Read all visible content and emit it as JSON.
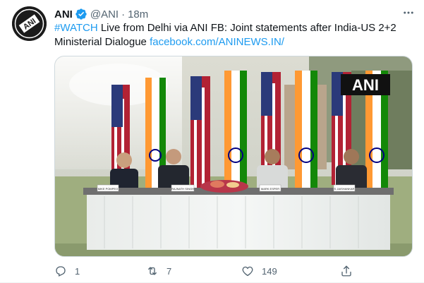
{
  "author": {
    "name": "ANI",
    "handle": "@ANI",
    "separator": "·",
    "time": "18m",
    "avatar_text": "ANI",
    "verified_icon": "verified-badge-icon",
    "verified_color": "#1d9bf0"
  },
  "tweet": {
    "hashtag": "#WATCH",
    "text_line1_rest": " Live from Delhi via ANI FB: Joint statements after India-US 2+2",
    "text_line2": "Ministerial Dialogue ",
    "link": "facebook.com/ANINEWS.IN/"
  },
  "media": {
    "watermark": "ANI",
    "nameplates": [
      "MIKE POMPEO",
      "RAJNATH SINGH",
      "MARK ESPER",
      "S JAISHANKAR"
    ]
  },
  "actions": {
    "reply_count": "1",
    "retweet_count": "7",
    "like_count": "149",
    "reply_icon": "reply-icon",
    "retweet_icon": "retweet-icon",
    "like_icon": "heart-icon",
    "share_icon": "share-icon"
  },
  "colors": {
    "link": "#1d9bf0",
    "secondary_text": "#536471",
    "primary_text": "#0f1419"
  }
}
